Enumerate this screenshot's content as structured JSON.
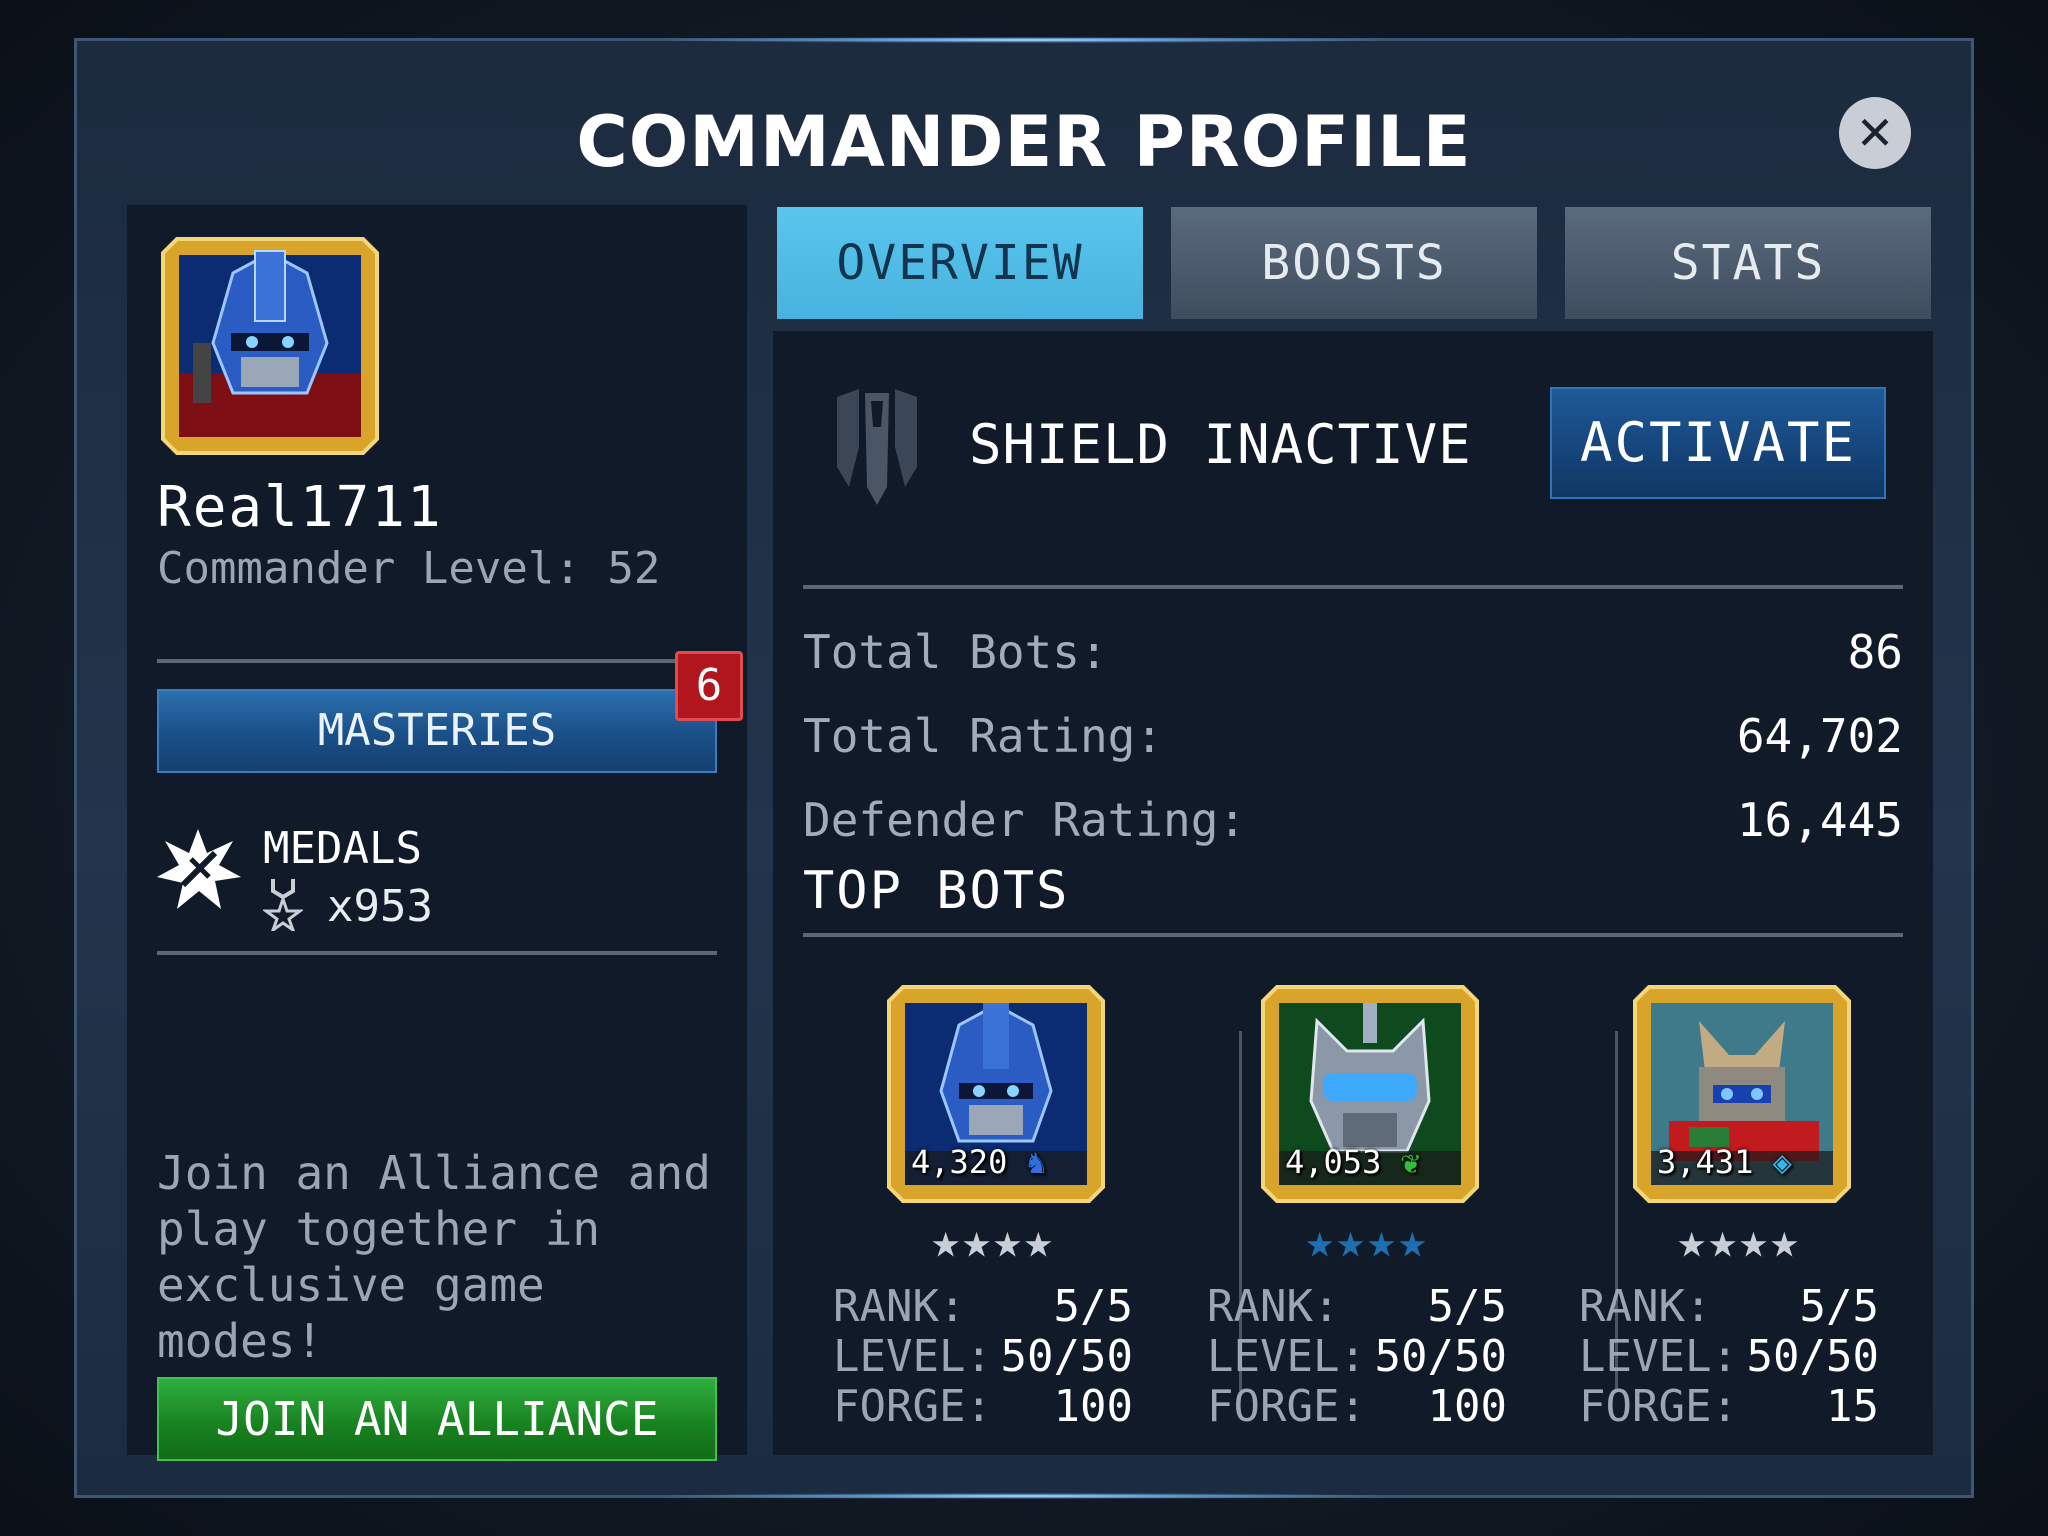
{
  "window": {
    "title": "COMMANDER PROFILE",
    "close_icon": "close-icon"
  },
  "profile": {
    "username": "Real1711",
    "commander_level": "Commander Level: 52",
    "masteries_label": "MASTERIES",
    "masteries_badge": "6",
    "medals_label": "MEDALS",
    "medals_count": "x953",
    "alliance_text": "Join an Alliance and play together in exclusive game modes!",
    "join_label": "JOIN AN ALLIANCE"
  },
  "tabs": [
    {
      "label": "OVERVIEW",
      "active": true
    },
    {
      "label": "BOOSTS",
      "active": false
    },
    {
      "label": "STATS",
      "active": false
    }
  ],
  "overview": {
    "shield_status": "SHIELD INACTIVE",
    "activate_label": "ACTIVATE",
    "stats": [
      {
        "label": "Total Bots:",
        "value": "86"
      },
      {
        "label": "Total Rating:",
        "value": "64,702"
      },
      {
        "label": "Defender Rating:",
        "value": "16,445"
      }
    ],
    "top_bots_title": "TOP BOTS",
    "bots": [
      {
        "rating": "4,320",
        "class_icon": "knight-icon",
        "stars": "★★★★",
        "star_color": "#c9ced6",
        "rank_label": "RANK:",
        "rank": "5/5",
        "level_label": "LEVEL:",
        "level": "50/50",
        "forge_label": "FORGE:",
        "forge": "100"
      },
      {
        "rating": "4,053",
        "class_icon": "wings-icon",
        "stars": "★★★★",
        "star_color": "#1d6fb0",
        "rank_label": "RANK:",
        "rank": "5/5",
        "level_label": "LEVEL:",
        "level": "50/50",
        "forge_label": "FORGE:",
        "forge": "100"
      },
      {
        "rating": "3,431",
        "class_icon": "tech-icon",
        "stars": "★★★★",
        "star_color": "#c9ced6",
        "rank_label": "RANK:",
        "rank": "5/5",
        "level_label": "LEVEL:",
        "level": "50/50",
        "forge_label": "FORGE:",
        "forge": "15"
      }
    ]
  },
  "colors": {
    "accent_tab": "#47b3de",
    "activate": "#154479",
    "join": "#17801f",
    "badge": "#b1151d",
    "frame_gold": "#d8a52a"
  }
}
